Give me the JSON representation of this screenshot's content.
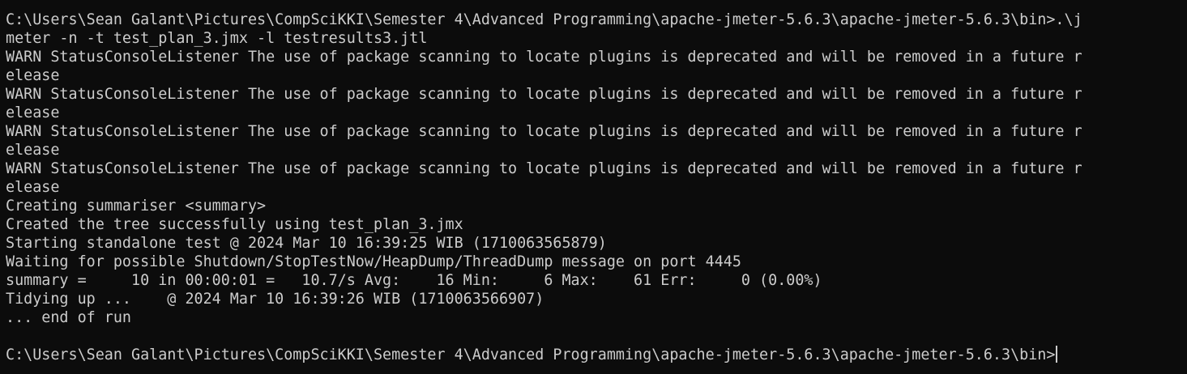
{
  "terminal": {
    "lines": [
      "C:\\Users\\Sean Galant\\Pictures\\CompSciKKI\\Semester 4\\Advanced Programming\\apache-jmeter-5.6.3\\apache-jmeter-5.6.3\\bin>.\\j",
      "meter -n -t test_plan_3.jmx -l testresults3.jtl",
      "WARN StatusConsoleListener The use of package scanning to locate plugins is deprecated and will be removed in a future r",
      "elease",
      "WARN StatusConsoleListener The use of package scanning to locate plugins is deprecated and will be removed in a future r",
      "elease",
      "WARN StatusConsoleListener The use of package scanning to locate plugins is deprecated and will be removed in a future r",
      "elease",
      "WARN StatusConsoleListener The use of package scanning to locate plugins is deprecated and will be removed in a future r",
      "elease",
      "Creating summariser <summary>",
      "Created the tree successfully using test_plan_3.jmx",
      "Starting standalone test @ 2024 Mar 10 16:39:25 WIB (1710063565879)",
      "Waiting for possible Shutdown/StopTestNow/HeapDump/ThreadDump message on port 4445",
      "summary =     10 in 00:00:01 =   10.7/s Avg:    16 Min:     6 Max:    61 Err:     0 (0.00%)",
      "Tidying up ...    @ 2024 Mar 10 16:39:26 WIB (1710063566907)",
      "... end of run",
      ""
    ],
    "prompt": "C:\\Users\\Sean Galant\\Pictures\\CompSciKKI\\Semester 4\\Advanced Programming\\apache-jmeter-5.6.3\\apache-jmeter-5.6.3\\bin>"
  }
}
